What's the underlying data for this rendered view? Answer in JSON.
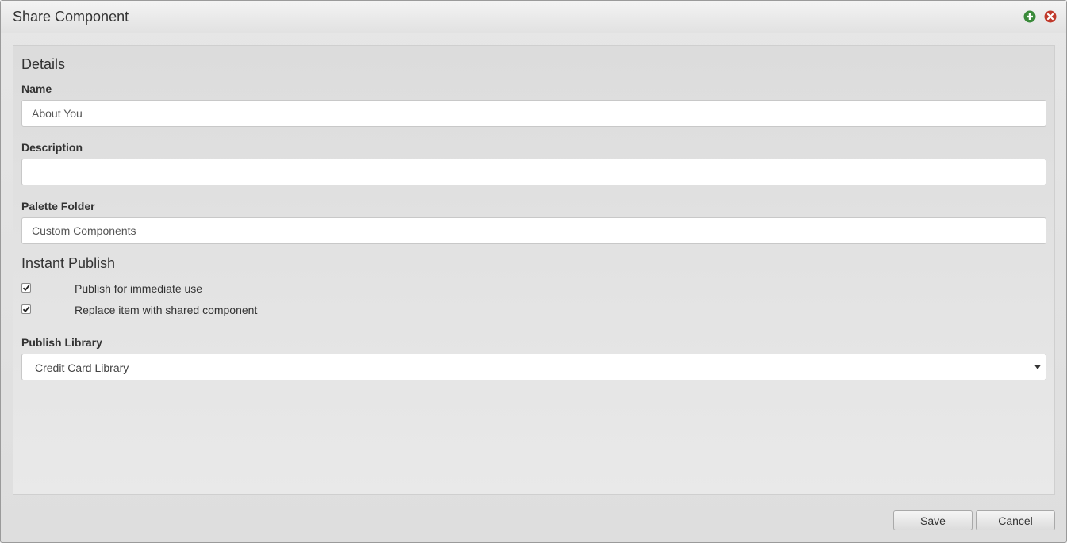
{
  "dialog": {
    "title": "Share Component",
    "icons": {
      "add": "add-circle-icon",
      "close": "close-circle-icon"
    }
  },
  "details": {
    "heading": "Details",
    "name_label": "Name",
    "name_value": "About You",
    "description_label": "Description",
    "description_value": "",
    "folder_label": "Palette Folder",
    "folder_value": "Custom Components"
  },
  "instant_publish": {
    "heading": "Instant Publish",
    "options": [
      {
        "label": "Publish for immediate use",
        "checked": true
      },
      {
        "label": "Replace item with shared component",
        "checked": true
      }
    ],
    "library_label": "Publish Library",
    "library_selected": "Credit Card Library"
  },
  "footer": {
    "save_label": "Save",
    "cancel_label": "Cancel"
  },
  "colors": {
    "add_icon": "#3a8a3a",
    "close_icon": "#c0392b"
  }
}
